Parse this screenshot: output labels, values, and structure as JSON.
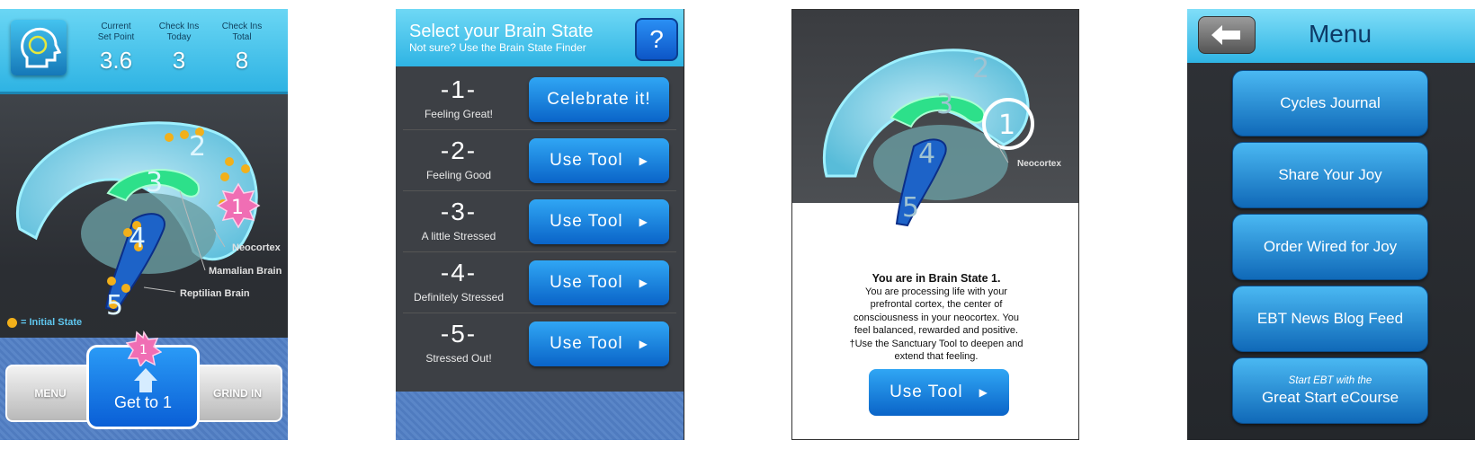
{
  "screen1": {
    "stats": [
      {
        "label_line1": "Current",
        "label_line2": "Set Point",
        "value": "3.6"
      },
      {
        "label_line1": "Check Ins",
        "label_line2": "Today",
        "value": "3"
      },
      {
        "label_line1": "Check Ins",
        "label_line2": "Total",
        "value": "8"
      }
    ],
    "brain_numbers": [
      "1",
      "2",
      "3",
      "4",
      "5"
    ],
    "labels": {
      "neocortex": "Neocortex",
      "mamalian": "Mamalian Brain",
      "reptilian": "Reptilian Brain"
    },
    "legend": "= Initial State",
    "buttons": {
      "menu": "MENU",
      "get_to_1": "Get to 1",
      "grind_in": "GRIND IN",
      "badge": "1"
    },
    "colors": {
      "accent": "#2eb3e3",
      "dot": "#f2b01a",
      "star": "#f06eb4"
    }
  },
  "screen2": {
    "title": "Select your Brain State",
    "subtitle": "Not sure? Use the Brain State Finder",
    "help": "?",
    "states": [
      {
        "num": "-1-",
        "name": "Feeling Great!",
        "button": "Celebrate it!",
        "arrow": ""
      },
      {
        "num": "-2-",
        "name": "Feeling Good",
        "button": "Use Tool",
        "arrow": "▶"
      },
      {
        "num": "-3-",
        "name": "A little Stressed",
        "button": "Use Tool",
        "arrow": "▶"
      },
      {
        "num": "-4-",
        "name": "Definitely Stressed",
        "button": "Use Tool",
        "arrow": "▶"
      },
      {
        "num": "-5-",
        "name": "Stressed Out!",
        "button": "Use Tool",
        "arrow": "▶"
      }
    ]
  },
  "screen3": {
    "brain_numbers": [
      "1",
      "2",
      "3",
      "4",
      "5"
    ],
    "neocortex_label": "Neocortex",
    "heading": "You are in Brain State 1.",
    "lines": [
      "You are processing life with your",
      "prefrontal cortex, the center of",
      "consciousness in your neocortex.  You",
      "feel balanced, rewarded and positive.",
      "†Use the Sanctuary Tool to deepen and",
      "extend that feeling."
    ],
    "button": "Use Tool",
    "arrow": "▶"
  },
  "screen4": {
    "title": "Menu",
    "items": [
      {
        "small": "",
        "label": "Cycles Journal"
      },
      {
        "small": "",
        "label": "Share Your Joy"
      },
      {
        "small": "",
        "label": "Order Wired for Joy"
      },
      {
        "small": "",
        "label": "EBT News Blog Feed"
      },
      {
        "small": "Start EBT with the",
        "label": "Great Start eCourse"
      }
    ]
  }
}
